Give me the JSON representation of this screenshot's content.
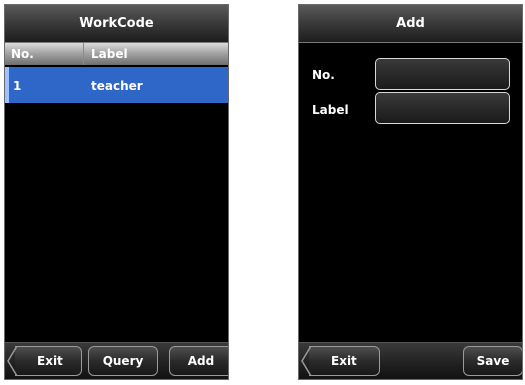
{
  "left_screen": {
    "title": "WorkCode",
    "table": {
      "columns": [
        "No.",
        "Label"
      ],
      "rows": [
        {
          "no": "1",
          "label": "teacher"
        }
      ]
    },
    "buttons": {
      "exit": "Exit",
      "query": "Query",
      "add": "Add"
    }
  },
  "right_screen": {
    "title": "Add",
    "form": {
      "no_label": "No.",
      "no_value": "",
      "label_label": "Label",
      "label_value": ""
    },
    "buttons": {
      "exit": "Exit",
      "save": "Save"
    }
  }
}
